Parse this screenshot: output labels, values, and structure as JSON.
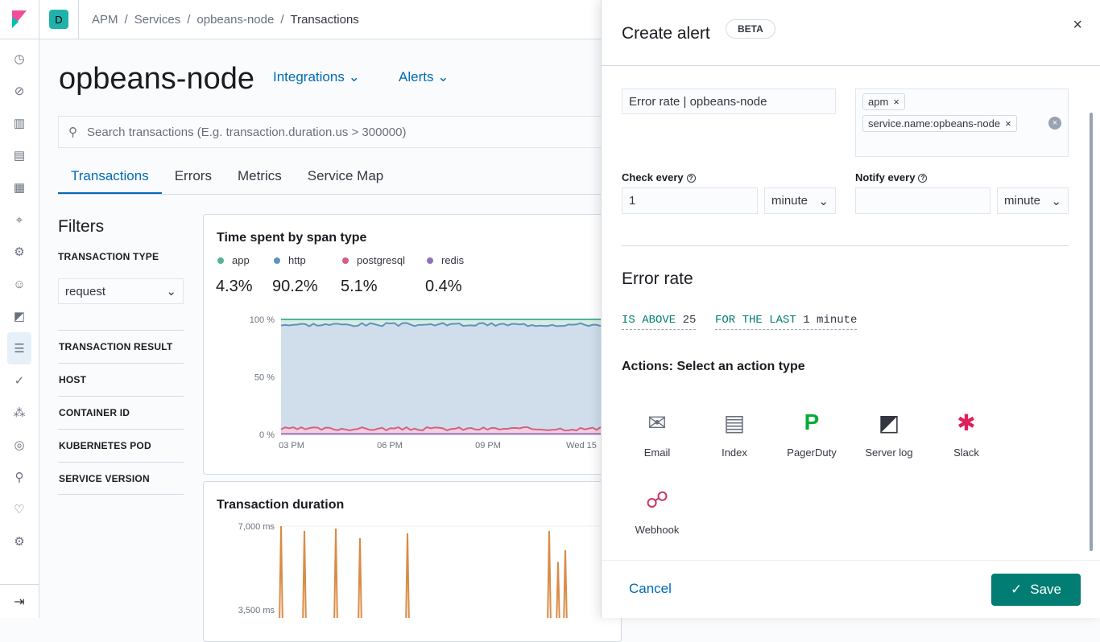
{
  "breadcrumbs": [
    "APM",
    "Services",
    "opbeans-node",
    "Transactions"
  ],
  "user_initial": "D",
  "service": {
    "title": "opbeans-node",
    "integrations": "Integrations",
    "alerts": "Alerts"
  },
  "search": {
    "placeholder": "Search transactions (E.g. transaction.duration.us > 300000)"
  },
  "tabs": [
    "Transactions",
    "Errors",
    "Metrics",
    "Service Map"
  ],
  "filters": {
    "title": "Filters",
    "type_label": "TRANSACTION TYPE",
    "type_value": "request",
    "items": [
      "TRANSACTION RESULT",
      "HOST",
      "CONTAINER ID",
      "KUBERNETES POD",
      "SERVICE VERSION"
    ]
  },
  "span_chart": {
    "title": "Time spent by span type",
    "legend": [
      {
        "name": "app",
        "value": "4.3%",
        "color": "#54b399"
      },
      {
        "name": "http",
        "value": "90.2%",
        "color": "#6092c0"
      },
      {
        "name": "postgresql",
        "value": "5.1%",
        "color": "#d36086"
      },
      {
        "name": "redis",
        "value": "0.4%",
        "color": "#9170b8"
      }
    ],
    "yticks": [
      "100 %",
      "50 %",
      "0 %"
    ],
    "xticks": [
      "03 PM",
      "06 PM",
      "09 PM",
      "Wed 15"
    ]
  },
  "duration_chart": {
    "title": "Transaction duration",
    "yticks": [
      "7,000 ms",
      "3,500 ms"
    ],
    "color": "#da8b45"
  },
  "chart_data": [
    {
      "type": "area",
      "title": "Time spent by span type",
      "ylim": [
        0,
        100
      ],
      "categories": [
        "03 PM",
        "06 PM",
        "09 PM",
        "Wed 15"
      ],
      "series": [
        {
          "name": "redis",
          "values": [
            0.4,
            0.4,
            0.4,
            0.4
          ]
        },
        {
          "name": "postgresql",
          "values": [
            5,
            6,
            5,
            5
          ]
        },
        {
          "name": "http",
          "values": [
            90,
            89,
            90,
            90
          ]
        },
        {
          "name": "app",
          "values": [
            4.6,
            4.6,
            4.6,
            4.6
          ]
        }
      ]
    },
    {
      "type": "line",
      "title": "Transaction duration",
      "yticks": [
        "7,000 ms",
        "3,500 ms"
      ],
      "peaks_ms": [
        7000,
        6800,
        6900,
        6500,
        6700,
        6800,
        5500,
        6000,
        7000
      ]
    }
  ],
  "flyout": {
    "title": "Create alert",
    "beta": "BETA",
    "name_value": "Error rate | opbeans-node",
    "tags": [
      "apm",
      "service.name:opbeans-node"
    ],
    "check_label": "Check every",
    "check_value": "1",
    "check_unit": "minute",
    "notify_label": "Notify every",
    "notify_value": "",
    "notify_unit": "minute",
    "section": "Error rate",
    "expr": {
      "above_kw": "IS ABOVE",
      "above_val": "25",
      "last_kw": "FOR THE LAST",
      "last_val": "1 minute"
    },
    "actions_title": "Actions: Select an action type",
    "actions": [
      {
        "label": "Email",
        "icon": "✉"
      },
      {
        "label": "Index",
        "icon": "▤"
      },
      {
        "label": "PagerDuty",
        "icon": "P"
      },
      {
        "label": "Server log",
        "icon": "◩"
      },
      {
        "label": "Slack",
        "icon": "✱"
      },
      {
        "label": "Webhook",
        "icon": "☍"
      }
    ],
    "cancel": "Cancel",
    "save": "Save"
  }
}
